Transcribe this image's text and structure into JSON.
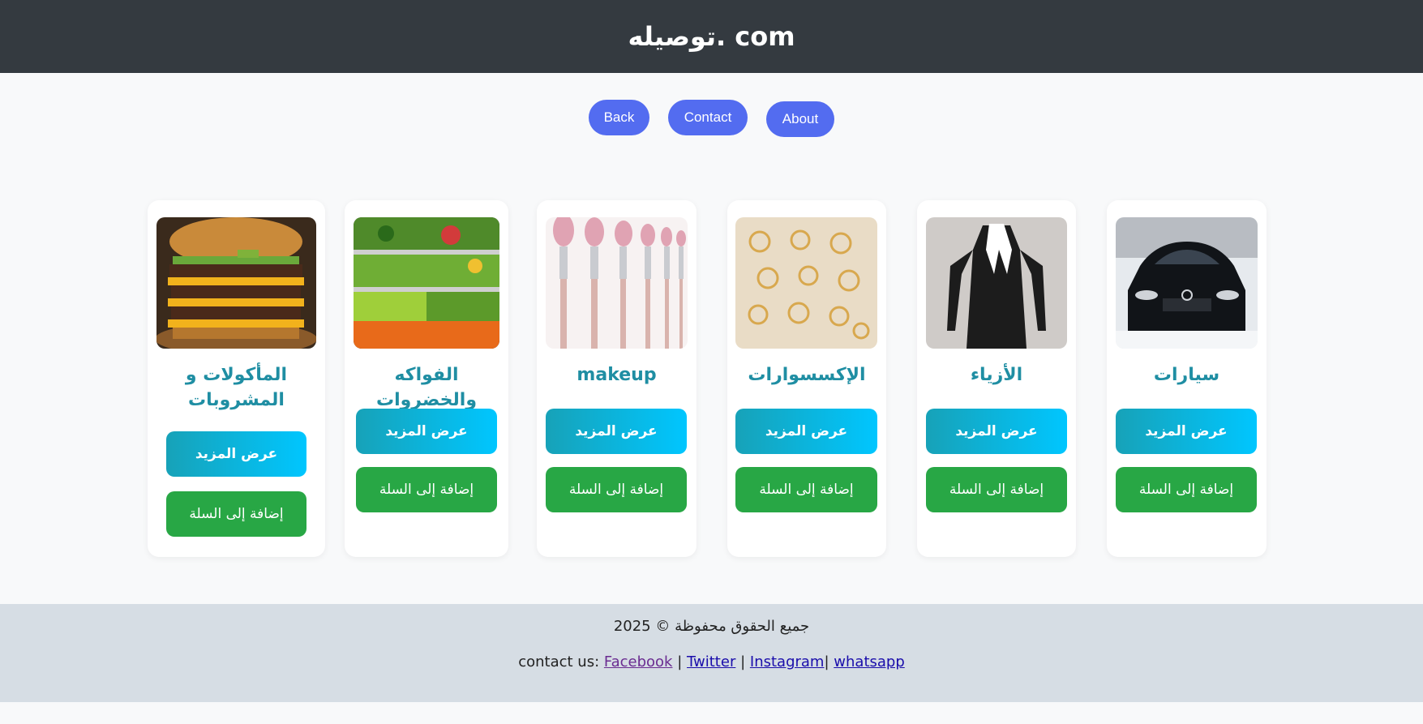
{
  "header": {
    "title": "توصيله. com"
  },
  "nav": {
    "back": "Back",
    "contact": "Contact",
    "about": "About"
  },
  "cards": [
    {
      "title": "المأكولات و المشروبات",
      "image": "burger-image",
      "more": "عرض المزيد",
      "cart": "إضافة إلى السلة"
    },
    {
      "title": "الفواكه والخضروات",
      "image": "vegetables-image",
      "more": "عرض المزيد",
      "cart": "إضافة إلى السلة"
    },
    {
      "title": "makeup",
      "image": "makeup-brushes-image",
      "more": "عرض المزيد",
      "cart": "إضافة إلى السلة"
    },
    {
      "title": "الإكسسوارات",
      "image": "rings-image",
      "more": "عرض المزيد",
      "cart": "إضافة إلى السلة"
    },
    {
      "title": "الأزياء",
      "image": "black-dress-image",
      "more": "عرض المزيد",
      "cart": "إضافة إلى السلة"
    },
    {
      "title": "سيارات",
      "image": "black-car-image",
      "more": "عرض المزيد",
      "cart": "إضافة إلى السلة"
    }
  ],
  "footer": {
    "copyright": "جميع الحقوق محفوظة © 2025",
    "contact_prefix": "contact us:",
    "links": [
      "Facebook",
      "Twitter",
      "Instagram",
      "whatsapp"
    ],
    "separators": [
      "|",
      "|",
      "|"
    ]
  },
  "colors": {
    "header_bg": "#343a40",
    "nav_button": "#536cf0",
    "card_title": "#1f8ea3",
    "more_button_start": "#17a2b8",
    "more_button_end": "#00c6ff",
    "cart_button": "#28a745",
    "footer_bg": "#d6dde4"
  }
}
